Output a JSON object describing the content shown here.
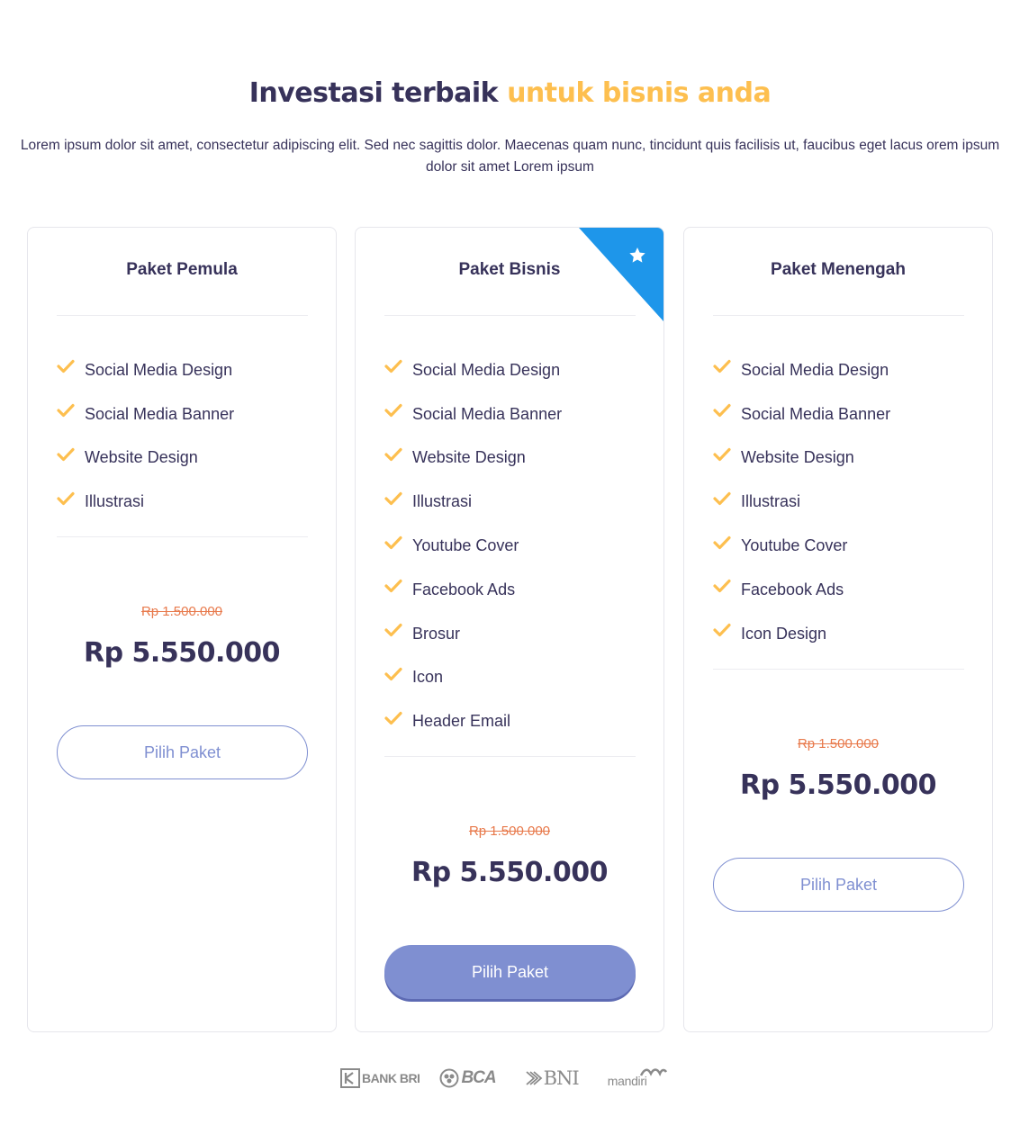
{
  "heading": {
    "main": "Investasi terbaik ",
    "accent": "untuk bisnis anda"
  },
  "subtitle": "Lorem ipsum dolor sit amet, consectetur adipiscing elit. Sed nec sagittis dolor. Maecenas quam nunc, tincidunt quis facilisis ut, faucibus eget lacus orem ipsum dolor sit amet Lorem ipsum",
  "colors": {
    "accent": "#fdbf4f",
    "text": "#37325a",
    "button": "#7f8fd1",
    "ribbon": "#1e96ea",
    "old_price": "#e87a4c"
  },
  "plans": [
    {
      "name": "Paket Pemula",
      "features": [
        "Social Media Design",
        "Social Media Banner",
        "Website Design",
        "Illustrasi"
      ],
      "old_price": "Rp 1.500.000",
      "price": "Rp 5.550.000",
      "button": "Pilih Paket",
      "featured": false
    },
    {
      "name": "Paket Bisnis",
      "features": [
        "Social Media Design",
        "Social Media Banner",
        "Website Design",
        "Illustrasi",
        "Youtube Cover",
        "Facebook Ads",
        "Brosur",
        "Icon",
        "Header Email"
      ],
      "old_price": "Rp 1.500.000",
      "price": "Rp 5.550.000",
      "button": "Pilih Paket",
      "featured": true,
      "badge_icon": "star-icon"
    },
    {
      "name": "Paket Menengah",
      "features": [
        "Social Media Design",
        "Social Media Banner",
        "Website Design",
        "Illustrasi",
        "Youtube Cover",
        "Facebook Ads",
        "Icon Design"
      ],
      "old_price": "Rp 1.500.000",
      "price": "Rp 5.550.000",
      "button": "Pilih Paket",
      "featured": false
    }
  ],
  "banks": [
    "BANK BRI",
    "BCA",
    "BNI",
    "mandiri"
  ]
}
